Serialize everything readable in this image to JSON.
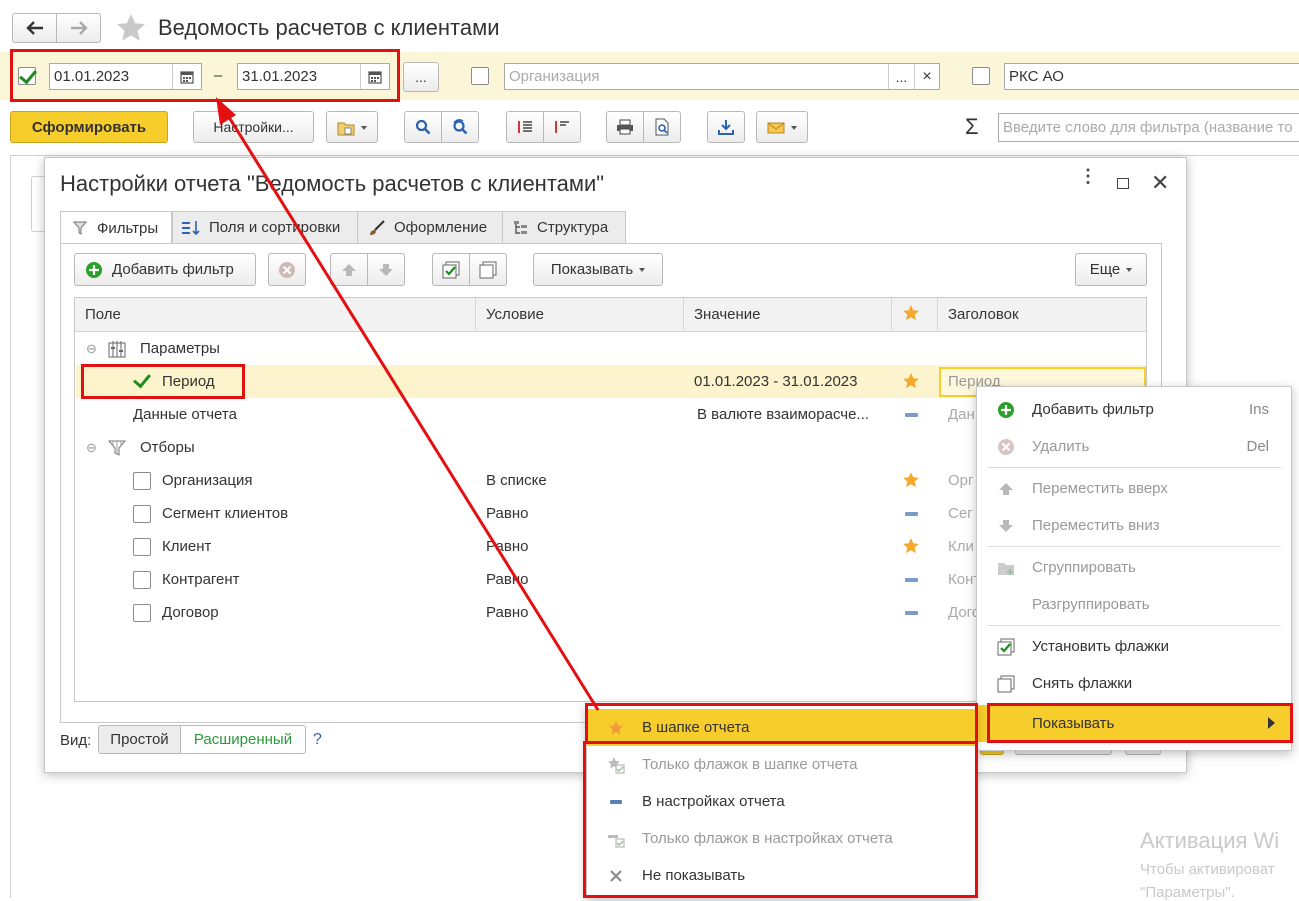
{
  "window": {
    "title": "Ведомость расчетов с клиентами"
  },
  "period": {
    "enabled": true,
    "from": "01.01.2023",
    "dash": "–",
    "to": "31.01.2023",
    "more_label": "..."
  },
  "organization": {
    "placeholder": "Организация",
    "dots": "...",
    "clear": "×"
  },
  "counterparty": {
    "value": "РКС АО"
  },
  "toolbar": {
    "generate_label": "Сформировать",
    "settings_label": "Настройки...",
    "search_placeholder": "Введите слово для фильтра (название то"
  },
  "dialog": {
    "title": "Настройки отчета \"Ведомость расчетов с клиентами\"",
    "tabs": [
      {
        "label": "Фильтры"
      },
      {
        "label": "Поля и сортировки"
      },
      {
        "label": "Оформление"
      },
      {
        "label": "Структура"
      }
    ],
    "add_filter_label": "Добавить фильтр",
    "show_label": "Показывать",
    "more_label": "Еще",
    "columns": {
      "field": "Поле",
      "condition": "Условие",
      "value": "Значение",
      "title": "Заголовок"
    },
    "rows": [
      {
        "field": "Параметры",
        "condition": "",
        "value": "",
        "title": ""
      },
      {
        "field": "Период",
        "condition": "",
        "value": "01.01.2023 - 31.01.2023",
        "title": "Период"
      },
      {
        "field": "Данные отчета",
        "condition": "",
        "value": "В валюте взаиморасче...",
        "title": "Дан"
      },
      {
        "field": "Отборы",
        "condition": "",
        "value": "",
        "title": ""
      },
      {
        "field": "Организация",
        "condition": "В списке",
        "value": "",
        "title": "Орг"
      },
      {
        "field": "Сегмент клиентов",
        "condition": "Равно",
        "value": "",
        "title": "Сег"
      },
      {
        "field": "Клиент",
        "condition": "Равно",
        "value": "",
        "title": "Кли"
      },
      {
        "field": "Контрагент",
        "condition": "Равно",
        "value": "",
        "title": "Конт"
      },
      {
        "field": "Договор",
        "condition": "Равно",
        "value": "",
        "title": "Дого"
      }
    ],
    "view_label": "Вид:",
    "view_simple": "Простой",
    "view_advanced": "Расширенный",
    "help": "?"
  },
  "context_menu": {
    "items": [
      {
        "label": "Добавить фильтр",
        "key": "Ins"
      },
      {
        "label": "Удалить",
        "key": "Del"
      },
      {
        "label": "Переместить вверх",
        "key": ""
      },
      {
        "label": "Переместить вниз",
        "key": ""
      },
      {
        "label": "Сгруппировать",
        "key": ""
      },
      {
        "label": "Разгруппировать",
        "key": ""
      },
      {
        "label": "Установить флажки",
        "key": ""
      },
      {
        "label": "Снять флажки",
        "key": ""
      },
      {
        "label": "Показывать",
        "key": ""
      }
    ]
  },
  "submenu": {
    "items": [
      {
        "label": "В шапке отчета"
      },
      {
        "label": "Только флажок в шапке отчета"
      },
      {
        "label": "В настройках отчета"
      },
      {
        "label": "Только флажок в настройках отчета"
      },
      {
        "label": "Не показывать"
      }
    ]
  },
  "watermark": {
    "line1": "Активация Wi",
    "line2": "Чтобы активироват",
    "line3": "\"Параметры\"."
  },
  "colors": {
    "accent_yellow": "#f7cd2b",
    "highlight_row": "#fdf3cc",
    "annotation_red": "#e21010",
    "star": "#f4a82c",
    "green": "#2aa02a"
  }
}
